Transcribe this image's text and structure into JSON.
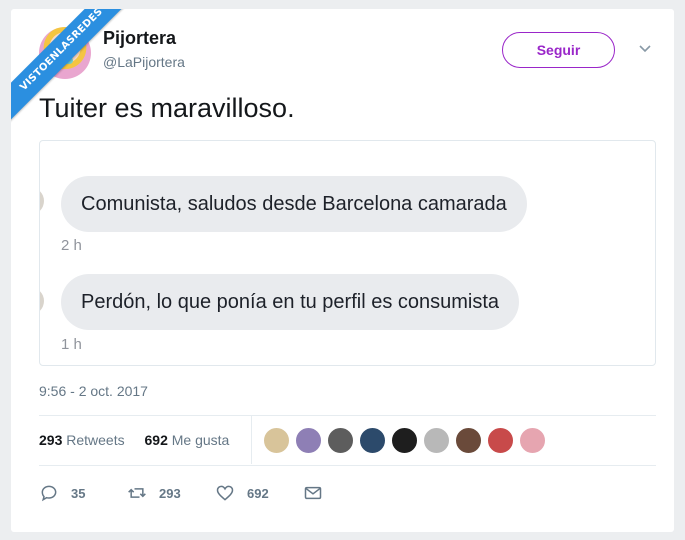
{
  "watermark": {
    "text": "VISTOENLASREDES"
  },
  "user": {
    "name": "Pijortera",
    "handle": "@LaPijortera"
  },
  "follow_label": "Seguir",
  "tweet_text": "Tuiter es maravilloso.",
  "chat": {
    "messages": [
      {
        "text": "Comunista, saludos desde Barcelona camarada",
        "time": "2 h"
      },
      {
        "text": "Perdón, lo que ponía en tu perfil es consumista",
        "time": "1 h"
      }
    ]
  },
  "timestamp": "9:56 - 2 oct. 2017",
  "stats": {
    "retweets_count": "293",
    "retweets_label": "Retweets",
    "likes_count": "692",
    "likes_label": "Me gusta"
  },
  "liker_colors": [
    "#d8c49a",
    "#8e7fb5",
    "#5d5d5d",
    "#2c4a6b",
    "#1e1e1e",
    "#b8b8b8",
    "#6a4a3a",
    "#c84a4a",
    "#e6a5b0"
  ],
  "actions": {
    "reply_count": "35",
    "retweet_count": "293",
    "like_count": "692"
  },
  "colors": {
    "accent": "#9a26c9",
    "ribbon": "#2b8fe0"
  }
}
